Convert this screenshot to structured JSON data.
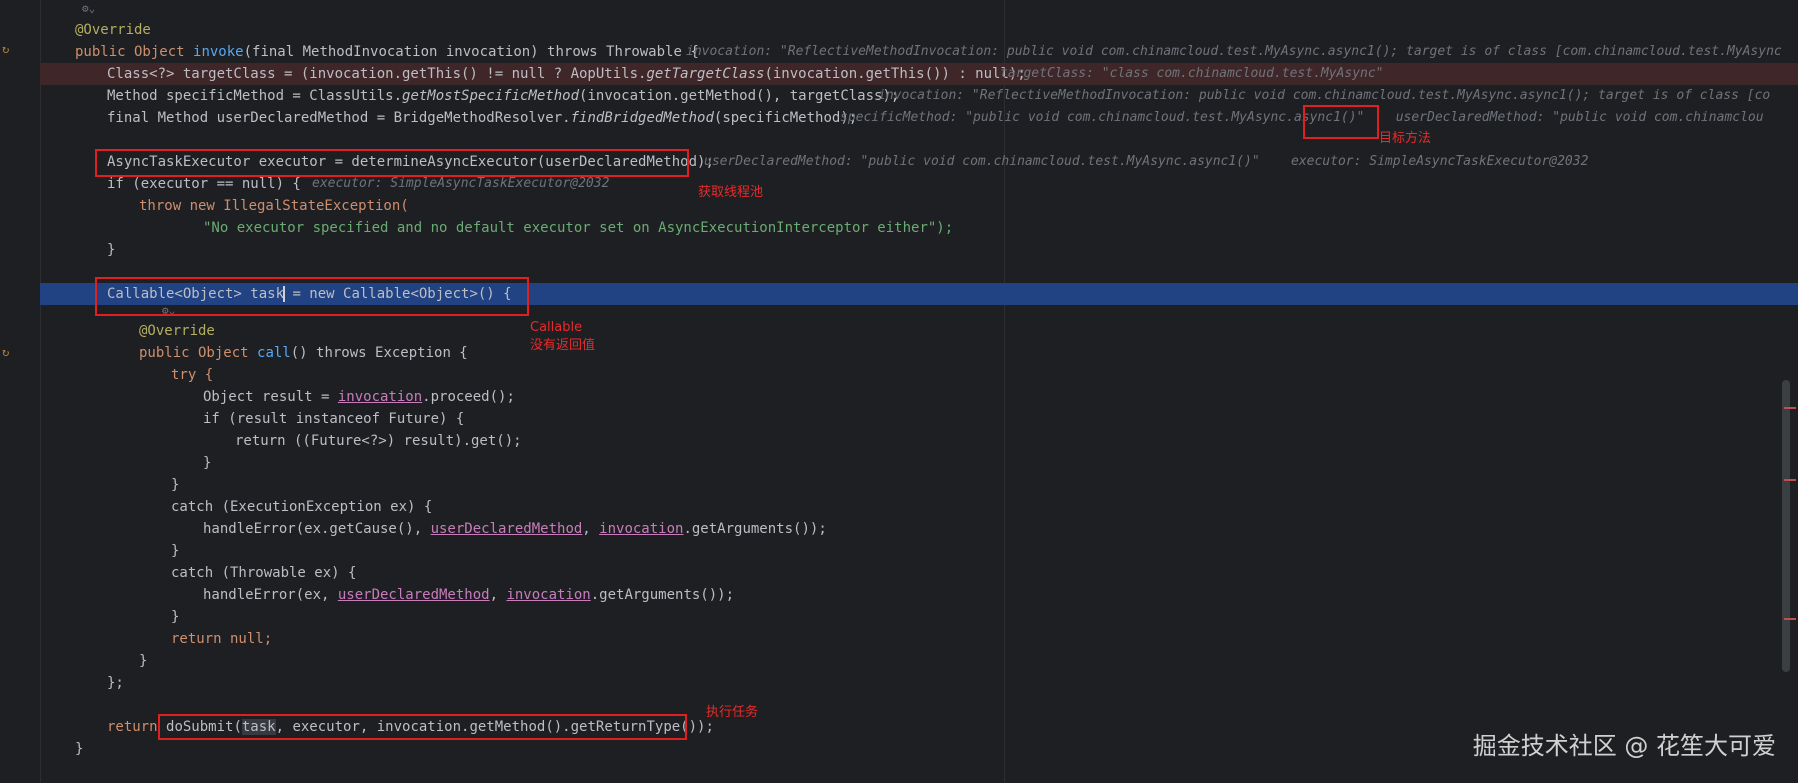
{
  "editor": {
    "lines": {
      "l1": "@Override",
      "l2_pre": "public Object ",
      "l2_fn": "invoke",
      "l2_post": "(final MethodInvocation invocation) throws Throwable {",
      "l2_hint": "invocation: \"ReflectiveMethodInvocation: public void com.chinamcloud.test.MyAsync.async1(); target is of class [com.chinamcloud.test.MyAsync",
      "l3_pre": "Class<?> targetClass = (invocation.getThis() != null ? AopUtils.",
      "l3_it": "getTargetClass",
      "l3_post": "(invocation.getThis()) : null);",
      "l3_hint": "targetClass: \"class com.chinamcloud.test.MyAsync\"",
      "l4_pre": "Method specificMethod = ClassUtils.",
      "l4_it": "getMostSpecificMethod",
      "l4_post": "(invocation.getMethod(), targetClass);",
      "l4_hint": "invocation: \"ReflectiveMethodInvocation: public void com.chinamcloud.test.MyAsync.async1(); target is of class [co",
      "l5_pre": "final Method userDeclaredMethod = BridgeMethodResolver.",
      "l5_it": "findBridgedMethod",
      "l5_post": "(specificMethod);",
      "l5_hint": "specificMethod: \"public void com.chinamcloud.test.MyAsync.async1()\"    userDeclaredMethod: \"public void com.chinamclou",
      "l6": "AsyncTaskExecutor executor = determineAsyncExecutor(userDeclaredMethod);",
      "l6_hint": "userDeclaredMethod: \"public void com.chinamcloud.test.MyAsync.async1()\"    executor: SimpleAsyncTaskExecutor@2032",
      "l7": "if (executor == null) {",
      "l7_hint": "executor: SimpleAsyncTaskExecutor@2032",
      "l8": "throw new IllegalStateException(",
      "l9": "\"No executor specified and no default executor set on AsyncExecutionInterceptor either\");",
      "l10": "}",
      "l11_a": "Callable<Object> task",
      "l11_b": " = new Callable<Object>() {",
      "l12": "@Override",
      "l13_pre": "public Object ",
      "l13_fn": "call",
      "l13_post": "() throws Exception {",
      "l14": "try {",
      "l15_pre": "Object result = ",
      "l15_var": "invocation",
      "l15_post": ".proceed();",
      "l16": "if (result instanceof Future) {",
      "l17": "return ((Future<?>) result).get();",
      "l18": "}",
      "l19": "}",
      "l20": "catch (ExecutionException ex) {",
      "l21_pre": "handleError(ex.getCause(), ",
      "l21_v1": "userDeclaredMethod",
      "l21_mid": ", ",
      "l21_v2": "invocation",
      "l21_post": ".getArguments());",
      "l22": "}",
      "l23": "catch (Throwable ex) {",
      "l24_pre": "handleError(ex, ",
      "l24_v1": "userDeclaredMethod",
      "l24_mid": ", ",
      "l24_v2": "invocation",
      "l24_post": ".getArguments());",
      "l25": "}",
      "l26": "return null;",
      "l27": "}",
      "l28": "};",
      "l29_kw": "return ",
      "l29_fn": "doSubmit(",
      "l29_task": "task",
      "l29_post": ", executor, invocation.getMethod().getReturnType());",
      "l30": "}"
    },
    "fold_icon": "⚙⌄",
    "gutter_icon": "↻"
  },
  "annotations": {
    "target_method": "目标方法",
    "get_pool": "获取线程池",
    "callable_1": "Callable",
    "callable_2": "没有返回值",
    "execute_task": "执行任务"
  },
  "watermark": "掘金技术社区 @ 花笙大可爱",
  "colors": {
    "keyword": "#cf8e6d",
    "function": "#56a8f5",
    "annotation": "#b3ae60",
    "string": "#6aab73",
    "param": "#c77dbb",
    "selection": "#214283",
    "red_box": "#e02020"
  }
}
